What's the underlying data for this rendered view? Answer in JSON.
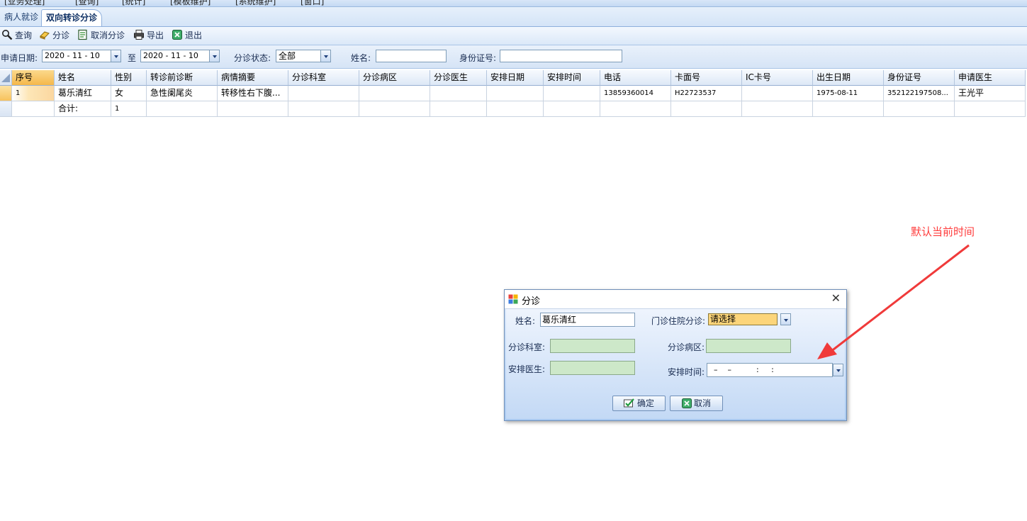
{
  "menu": {
    "items": [
      "[业务处理]",
      "[查询]",
      "[统计]",
      "[模板维护]",
      "[系统维护]",
      "[窗口]"
    ]
  },
  "tabs": [
    {
      "label": "病人就诊",
      "active": false
    },
    {
      "label": "双向转诊分诊",
      "active": true
    }
  ],
  "toolbar": {
    "query": "查询",
    "triage": "分诊",
    "cancel_triage": "取消分诊",
    "export": "导出",
    "exit": "退出"
  },
  "filters": {
    "apply_date_label": "申请日期:",
    "date_from": "2020 - 11 - 10",
    "to_label": "至",
    "date_to": "2020 - 11 - 10",
    "status_label": "分诊状态:",
    "status_value": "全部",
    "name_label": "姓名:",
    "name_value": "",
    "id_label": "身份证号:",
    "id_value": ""
  },
  "grid": {
    "headers": [
      "序号",
      "姓名",
      "性别",
      "转诊前诊断",
      "病情摘要",
      "分诊科室",
      "分诊病区",
      "分诊医生",
      "安排日期",
      "安排时间",
      "电话",
      "卡面号",
      "IC卡号",
      "出生日期",
      "身份证号",
      "申请医生"
    ],
    "rows": [
      [
        "1",
        "葛乐清红",
        "女",
        "急性阑尾炎",
        "转移性右下腹...",
        "",
        "",
        "",
        "",
        "",
        "13859360014",
        "H22723537",
        "",
        "1975-08-11",
        "352122197508...",
        "王光平"
      ]
    ],
    "total_row": [
      "",
      "合计:",
      "1",
      "",
      "",
      "",
      "",
      "",
      "",
      "",
      "",
      "",
      "",
      "",
      "",
      ""
    ]
  },
  "dialog": {
    "title": "分诊",
    "name_label": "姓名:",
    "name_value": "葛乐清红",
    "type_label": "门诊住院分诊:",
    "type_value": "请选择",
    "dept_label": "分诊科室:",
    "dept_value": "",
    "ward_label": "分诊病区:",
    "ward_value": "",
    "doctor_label": "安排医生:",
    "doctor_value": "",
    "time_label": "安排时间:",
    "time_value": "  –    –          :     :",
    "ok_label": "确定",
    "cancel_label": "取消"
  },
  "annotation": {
    "text": "默认当前时间",
    "color": "#ff3b3b"
  },
  "colors": {
    "accent": "#1d3e6e",
    "green_field": "#cde8c9",
    "yellow_field": "#fcd57a"
  }
}
